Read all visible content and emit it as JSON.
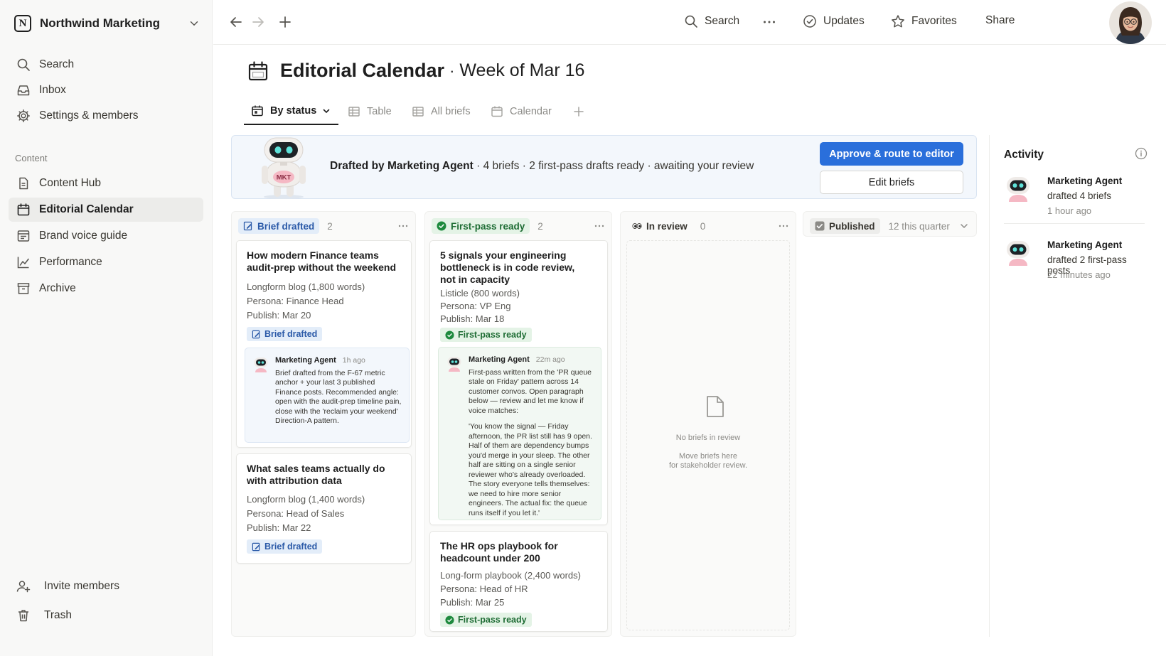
{
  "workspace": {
    "name": "Northwind Marketing"
  },
  "sidebar": {
    "top_items": [
      {
        "label": "Search",
        "icon": "search-icon"
      },
      {
        "label": "Inbox",
        "icon": "inbox-icon"
      },
      {
        "label": "Settings & members",
        "icon": "gear-icon"
      }
    ],
    "section_label": "Content",
    "content_items": [
      {
        "label": "Content Hub",
        "icon": "document-icon"
      },
      {
        "label": "Editorial Calendar",
        "icon": "calendar-icon",
        "active": true
      },
      {
        "label": "Brand voice guide",
        "icon": "page-icon"
      },
      {
        "label": "Performance",
        "icon": "chart-icon"
      },
      {
        "label": "Archive",
        "icon": "archive-icon"
      }
    ],
    "bottom_items": [
      {
        "label": "Invite members",
        "icon": "add-user-icon"
      },
      {
        "label": "Trash",
        "icon": "trash-icon"
      }
    ]
  },
  "topbar": {
    "search_label": "Search",
    "updates_label": "Updates",
    "favorites_label": "Favorites",
    "share_label": "Share"
  },
  "page": {
    "title": "Editorial Calendar",
    "separator": "·",
    "subtitle": "Week of Mar 16"
  },
  "tabs": [
    {
      "label": "By status",
      "active": true
    },
    {
      "label": "Table"
    },
    {
      "label": "All briefs"
    },
    {
      "label": "Calendar"
    }
  ],
  "banner": {
    "robot_badge": "MKT",
    "lead": "Drafted by Marketing Agent",
    "detail": " · 4 briefs · 2 first-pass drafts ready · awaiting your review",
    "primary_button": "Approve & route to editor",
    "secondary_button": "Edit briefs"
  },
  "columns": [
    {
      "label": "Brief drafted",
      "count": "2",
      "cards": [
        {
          "title": "How modern Finance teams audit-prep without the weekend",
          "format": "Longform blog (1,800 words)",
          "persona": "Persona: Finance Head",
          "publish": "Publish: Mar 20",
          "tag": "Brief drafted",
          "note": {
            "who": "Marketing Agent",
            "ago": "1h ago",
            "text": "Brief drafted from the F-67 metric anchor + your last 3 published Finance posts. Recommended angle: open with the audit-prep timeline pain, close with the 'reclaim your weekend' Direction-A pattern."
          }
        },
        {
          "title": "What sales teams actually do with attribution data",
          "format": "Longform blog (1,400 words)",
          "persona": "Persona: Head of Sales",
          "publish": "Publish: Mar 22",
          "tag": "Brief drafted"
        }
      ]
    },
    {
      "label": "First-pass ready",
      "count": "2",
      "cards": [
        {
          "title": "5 signals your engineering bottleneck is in code review, not in capacity",
          "format": "Listicle (800 words)",
          "persona": "Persona: VP Eng",
          "publish": "Publish: Mar 18",
          "tag": "First-pass ready",
          "note": {
            "who": "Marketing Agent",
            "ago": "22m ago",
            "text": "First-pass written from the 'PR queue stale on Friday' pattern across 14 customer convos. Open paragraph below — review and let me know if voice matches:",
            "quote": "'You know the signal — Friday afternoon, the PR list still has 9 open. Half of them are dependency bumps you'd merge in your sleep. The other half are sitting on a single senior reviewer who's already overloaded. The story everyone tells themselves: we need to hire more senior engineers. The actual fix: the queue runs itself if you let it.'"
          }
        },
        {
          "title": "The HR ops playbook for headcount under 200",
          "format": "Long-form playbook (2,400 words)",
          "persona": "Persona: Head of HR",
          "publish": "Publish: Mar 25",
          "tag": "First-pass ready"
        }
      ]
    },
    {
      "label": "In review",
      "count": "0",
      "empty_title": "No briefs in review",
      "empty_line1": "Move briefs here",
      "empty_line2": "for stakeholder review."
    },
    {
      "label": "Published",
      "count": "12 this quarter"
    }
  ],
  "activity": {
    "title": "Activity",
    "items": [
      {
        "who": "Marketing Agent",
        "what": "drafted 4 briefs",
        "when": "1 hour ago"
      },
      {
        "who": "Marketing Agent",
        "what": "drafted 2 first-pass posts",
        "when": "22 minutes ago"
      }
    ]
  },
  "colors": {
    "accent": "#2a6fdb",
    "brief_drafted": "#2b5aa8",
    "first_pass_ready": "#1f6d35",
    "sidebar_bg": "#f8f8f7"
  }
}
